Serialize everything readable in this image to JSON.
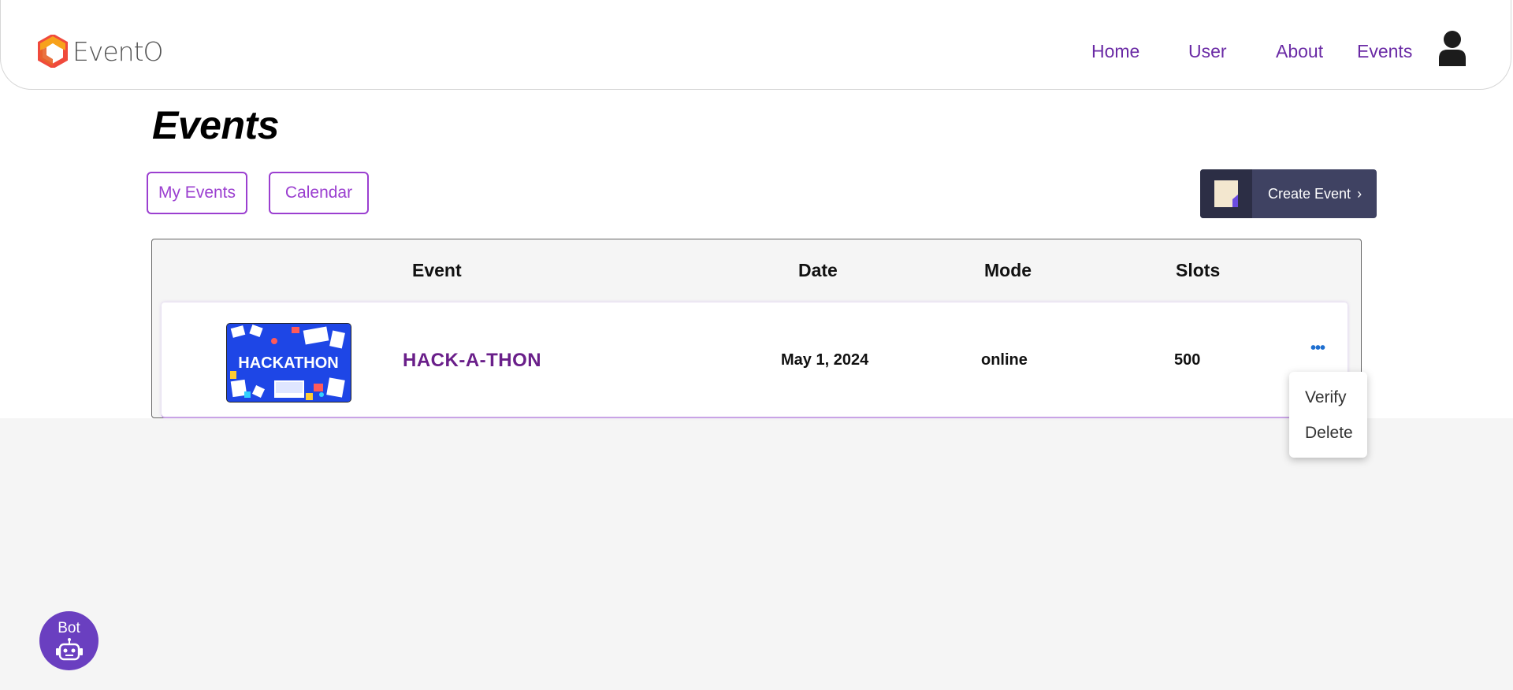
{
  "app": {
    "brand_name": "EventO",
    "brand_colors": [
      "#f04a3c",
      "#f7a21b"
    ],
    "accent_color": "#6a2aa5"
  },
  "nav": {
    "items": [
      {
        "label": "Home"
      },
      {
        "label": "User"
      },
      {
        "label": "About"
      },
      {
        "label": "Events"
      }
    ],
    "profile_icon": "user-icon"
  },
  "page": {
    "title": "Events"
  },
  "toolbar": {
    "my_events_label": "My Events",
    "calendar_label": "Calendar",
    "create_event_label": "Create Event",
    "create_event_chevron": "›"
  },
  "table": {
    "columns": {
      "event": "Event",
      "date": "Date",
      "mode": "Mode",
      "slots": "Slots"
    },
    "rows": [
      {
        "thumbnail_text": "HACKATHON",
        "name": "HACK-A-THON",
        "date": "May 1, 2024",
        "mode": "online",
        "slots": "500",
        "more_icon": "ellipsis-icon"
      }
    ]
  },
  "row_menu": {
    "items": [
      {
        "label": "Verify"
      },
      {
        "label": "Delete"
      }
    ]
  },
  "bot": {
    "label": "Bot",
    "icon": "robot-icon"
  }
}
